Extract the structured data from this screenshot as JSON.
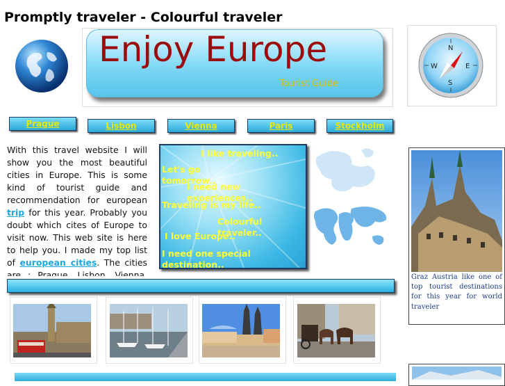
{
  "header": {
    "site_title": "Promptly traveler - Colourful traveler",
    "banner_title": "Enjoy Europe",
    "banner_subtitle": "Tourist Guide"
  },
  "nav": {
    "items": [
      {
        "label": "Prague"
      },
      {
        "label": "Lisbon"
      },
      {
        "label": "Vienna"
      },
      {
        "label": "Paris"
      },
      {
        "label": "Stockholm"
      }
    ]
  },
  "intro": {
    "part1": "With this travel website I will show you the most beautiful cities in Europe. This is some kind of tourist guide and recommendation for european ",
    "link1": "trip",
    "part2": " for this year. Probably you doubt which cites of Europe to visit now. This web site is here to help you. I made my top list of ",
    "link2": "european cities",
    "part3": ". The cities are : Prague, Lisbon, Vienna, Paris, Stockholm. Prepare your"
  },
  "slogans": {
    "s1": "I like traveling..",
    "s2": "Let's go tomorrow..",
    "s3": "I need new experiences..",
    "s4": "Traveling is my life..",
    "s5": "Colourful traveler..",
    "s6": "I love Europe..",
    "s7": "I need one special destination.."
  },
  "sidebar": {
    "graz_caption": "Graz Austria like one of top tourist destinations for this year for world traveler"
  },
  "icons": {
    "globe": "globe-icon",
    "compass": "compass-icon"
  },
  "colors": {
    "accent": "#2aa9d9",
    "banner_title": "#9b0d0d",
    "nav_text": "#e8e800",
    "slogan_text": "#ffff33",
    "link": "#1aa7e0"
  }
}
